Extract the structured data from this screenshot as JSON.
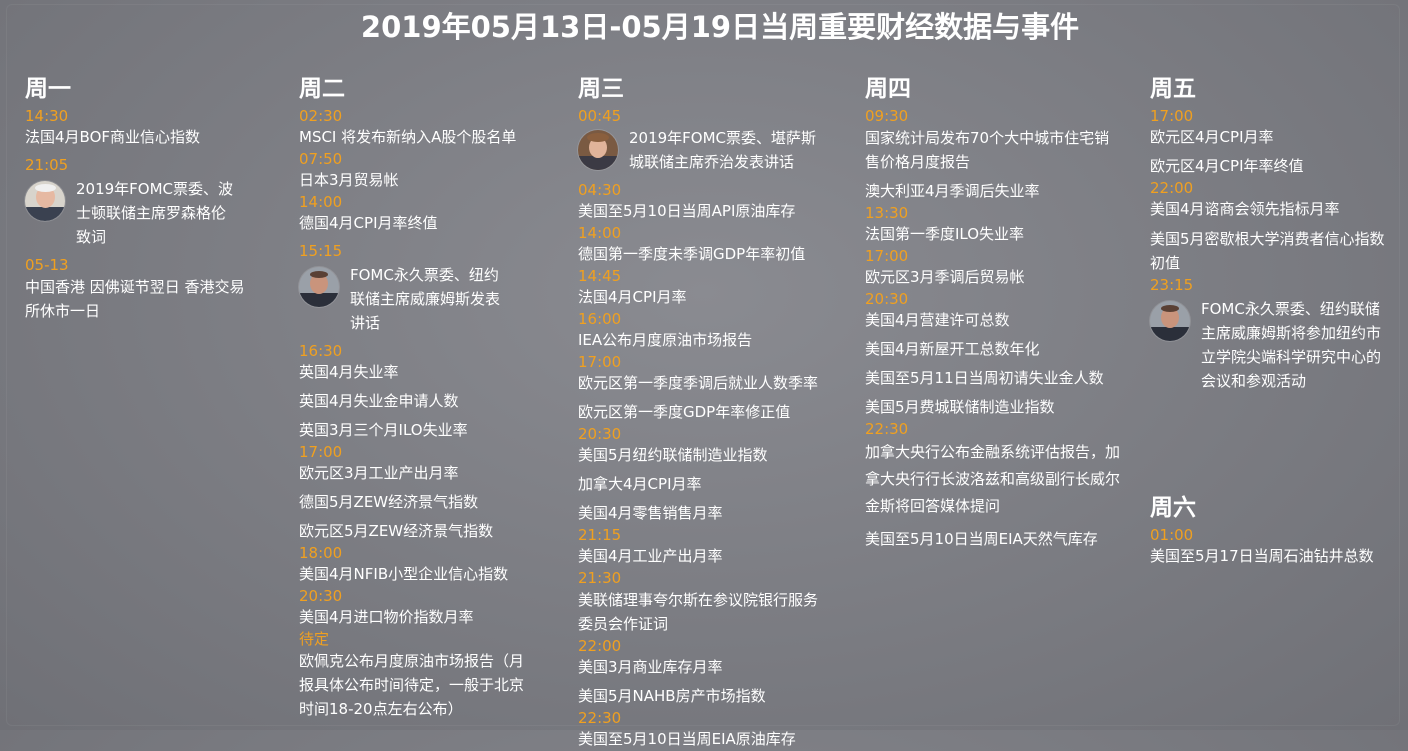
{
  "title": "2019年05月13日-05月19日当周重要财经数据与事件",
  "columns": [
    {
      "day": "周一",
      "entries": [
        {
          "time": "14:30",
          "events": [
            "法国4月BOF商业信心指数"
          ]
        },
        {
          "time": "21:05",
          "avatar": "person-avatar-rosengren",
          "text": "2019年FOMC票委、波士顿联储主席罗森格伦致词"
        },
        {
          "time": "05-13",
          "events": [
            "中国香港 因佛诞节翌日 香港交易所休市一日"
          ]
        }
      ]
    },
    {
      "day": "周二",
      "entries": [
        {
          "time": "02:30",
          "events": [
            "MSCI 将发布新纳入A股个股名单"
          ]
        },
        {
          "time": "07:50",
          "events": [
            "日本3月贸易帐"
          ]
        },
        {
          "time": "14:00",
          "events": [
            "德国4月CPI月率终值"
          ]
        },
        {
          "time": "15:15",
          "avatar": "person-avatar-williams",
          "text": "FOMC永久票委、纽约联储主席威廉姆斯发表讲话"
        },
        {
          "time": "16:30",
          "events": [
            "英国4月失业率",
            "英国4月失业金申请人数",
            "英国3月三个月ILO失业率"
          ]
        },
        {
          "time": "17:00",
          "events": [
            "欧元区3月工业产出月率",
            "德国5月ZEW经济景气指数",
            "欧元区5月ZEW经济景气指数"
          ]
        },
        {
          "time": "18:00",
          "events": [
            "美国4月NFIB小型企业信心指数"
          ]
        },
        {
          "time": "20:30",
          "events": [
            "美国4月进口物价指数月率"
          ]
        },
        {
          "time": "待定",
          "events": [
            "欧佩克公布月度原油市场报告（月报具体公布时间待定，一般于北京时间18-20点左右公布）"
          ]
        }
      ]
    },
    {
      "day": "周三",
      "entries": [
        {
          "time": "00:45",
          "avatar": "person-avatar-george",
          "text": "2019年FOMC票委、堪萨斯城联储主席乔治发表讲话"
        },
        {
          "time": "04:30",
          "events": [
            "美国至5月10日当周API原油库存"
          ]
        },
        {
          "time": "14:00",
          "events": [
            "德国第一季度未季调GDP年率初值"
          ]
        },
        {
          "time": "14:45",
          "events": [
            "法国4月CPI月率"
          ]
        },
        {
          "time": "16:00",
          "events": [
            "IEA公布月度原油市场报告"
          ]
        },
        {
          "time": "17:00",
          "events": [
            "欧元区第一季度季调后就业人数季率",
            "欧元区第一季度GDP年率修正值"
          ]
        },
        {
          "time": "20:30",
          "events": [
            "美国5月纽约联储制造业指数",
            "加拿大4月CPI月率",
            "美国4月零售销售月率"
          ]
        },
        {
          "time": "21:15",
          "events": [
            "美国4月工业产出月率"
          ]
        },
        {
          "time": "21:30",
          "events": [
            "美联储理事夸尔斯在参议院银行服务委员会作证词"
          ]
        },
        {
          "time": "22:00",
          "events": [
            "美国3月商业库存月率",
            "美国5月NAHB房产市场指数"
          ]
        },
        {
          "time": "22:30",
          "events": [
            "美国至5月10日当周EIA原油库存"
          ]
        }
      ]
    },
    {
      "day": "周四",
      "entries": [
        {
          "time": "09:30",
          "events": [
            "国家统计局发布70个大中城市住宅销售价格月度报告",
            "澳大利亚4月季调后失业率"
          ]
        },
        {
          "time": "13:30",
          "events": [
            "法国第一季度ILO失业率"
          ]
        },
        {
          "time": "17:00",
          "events": [
            "欧元区3月季调后贸易帐"
          ]
        },
        {
          "time": "20:30",
          "events": [
            "美国4月营建许可总数",
            "美国4月新屋开工总数年化",
            "美国至5月11日当周初请失业金人数",
            "美国5月费城联储制造业指数"
          ]
        },
        {
          "time": "22:30",
          "events": [
            "加拿大央行公布金融系统评估报告，加拿大央行行长波洛兹和高级副行长威尔金斯将回答媒体提问",
            "美国至5月10日当周EIA天然气库存"
          ]
        }
      ]
    },
    {
      "day": "周五",
      "entries": [
        {
          "time": "17:00",
          "events": [
            "欧元区4月CPI月率",
            "欧元区4月CPI年率终值"
          ]
        },
        {
          "time": "22:00",
          "events": [
            "美国4月谘商会领先指标月率",
            "美国5月密歇根大学消费者信心指数初值"
          ]
        },
        {
          "time": "23:15",
          "avatar": "person-avatar-williams",
          "text": "FOMC永久票委、纽约联储主席威廉姆斯将参加纽约市立学院尖端科学研究中心的会议和参观活动"
        }
      ]
    },
    {
      "day": "周六",
      "entries": [
        {
          "time": "01:00",
          "events": [
            "美国至5月17日当周石油钻井总数"
          ]
        }
      ]
    }
  ]
}
